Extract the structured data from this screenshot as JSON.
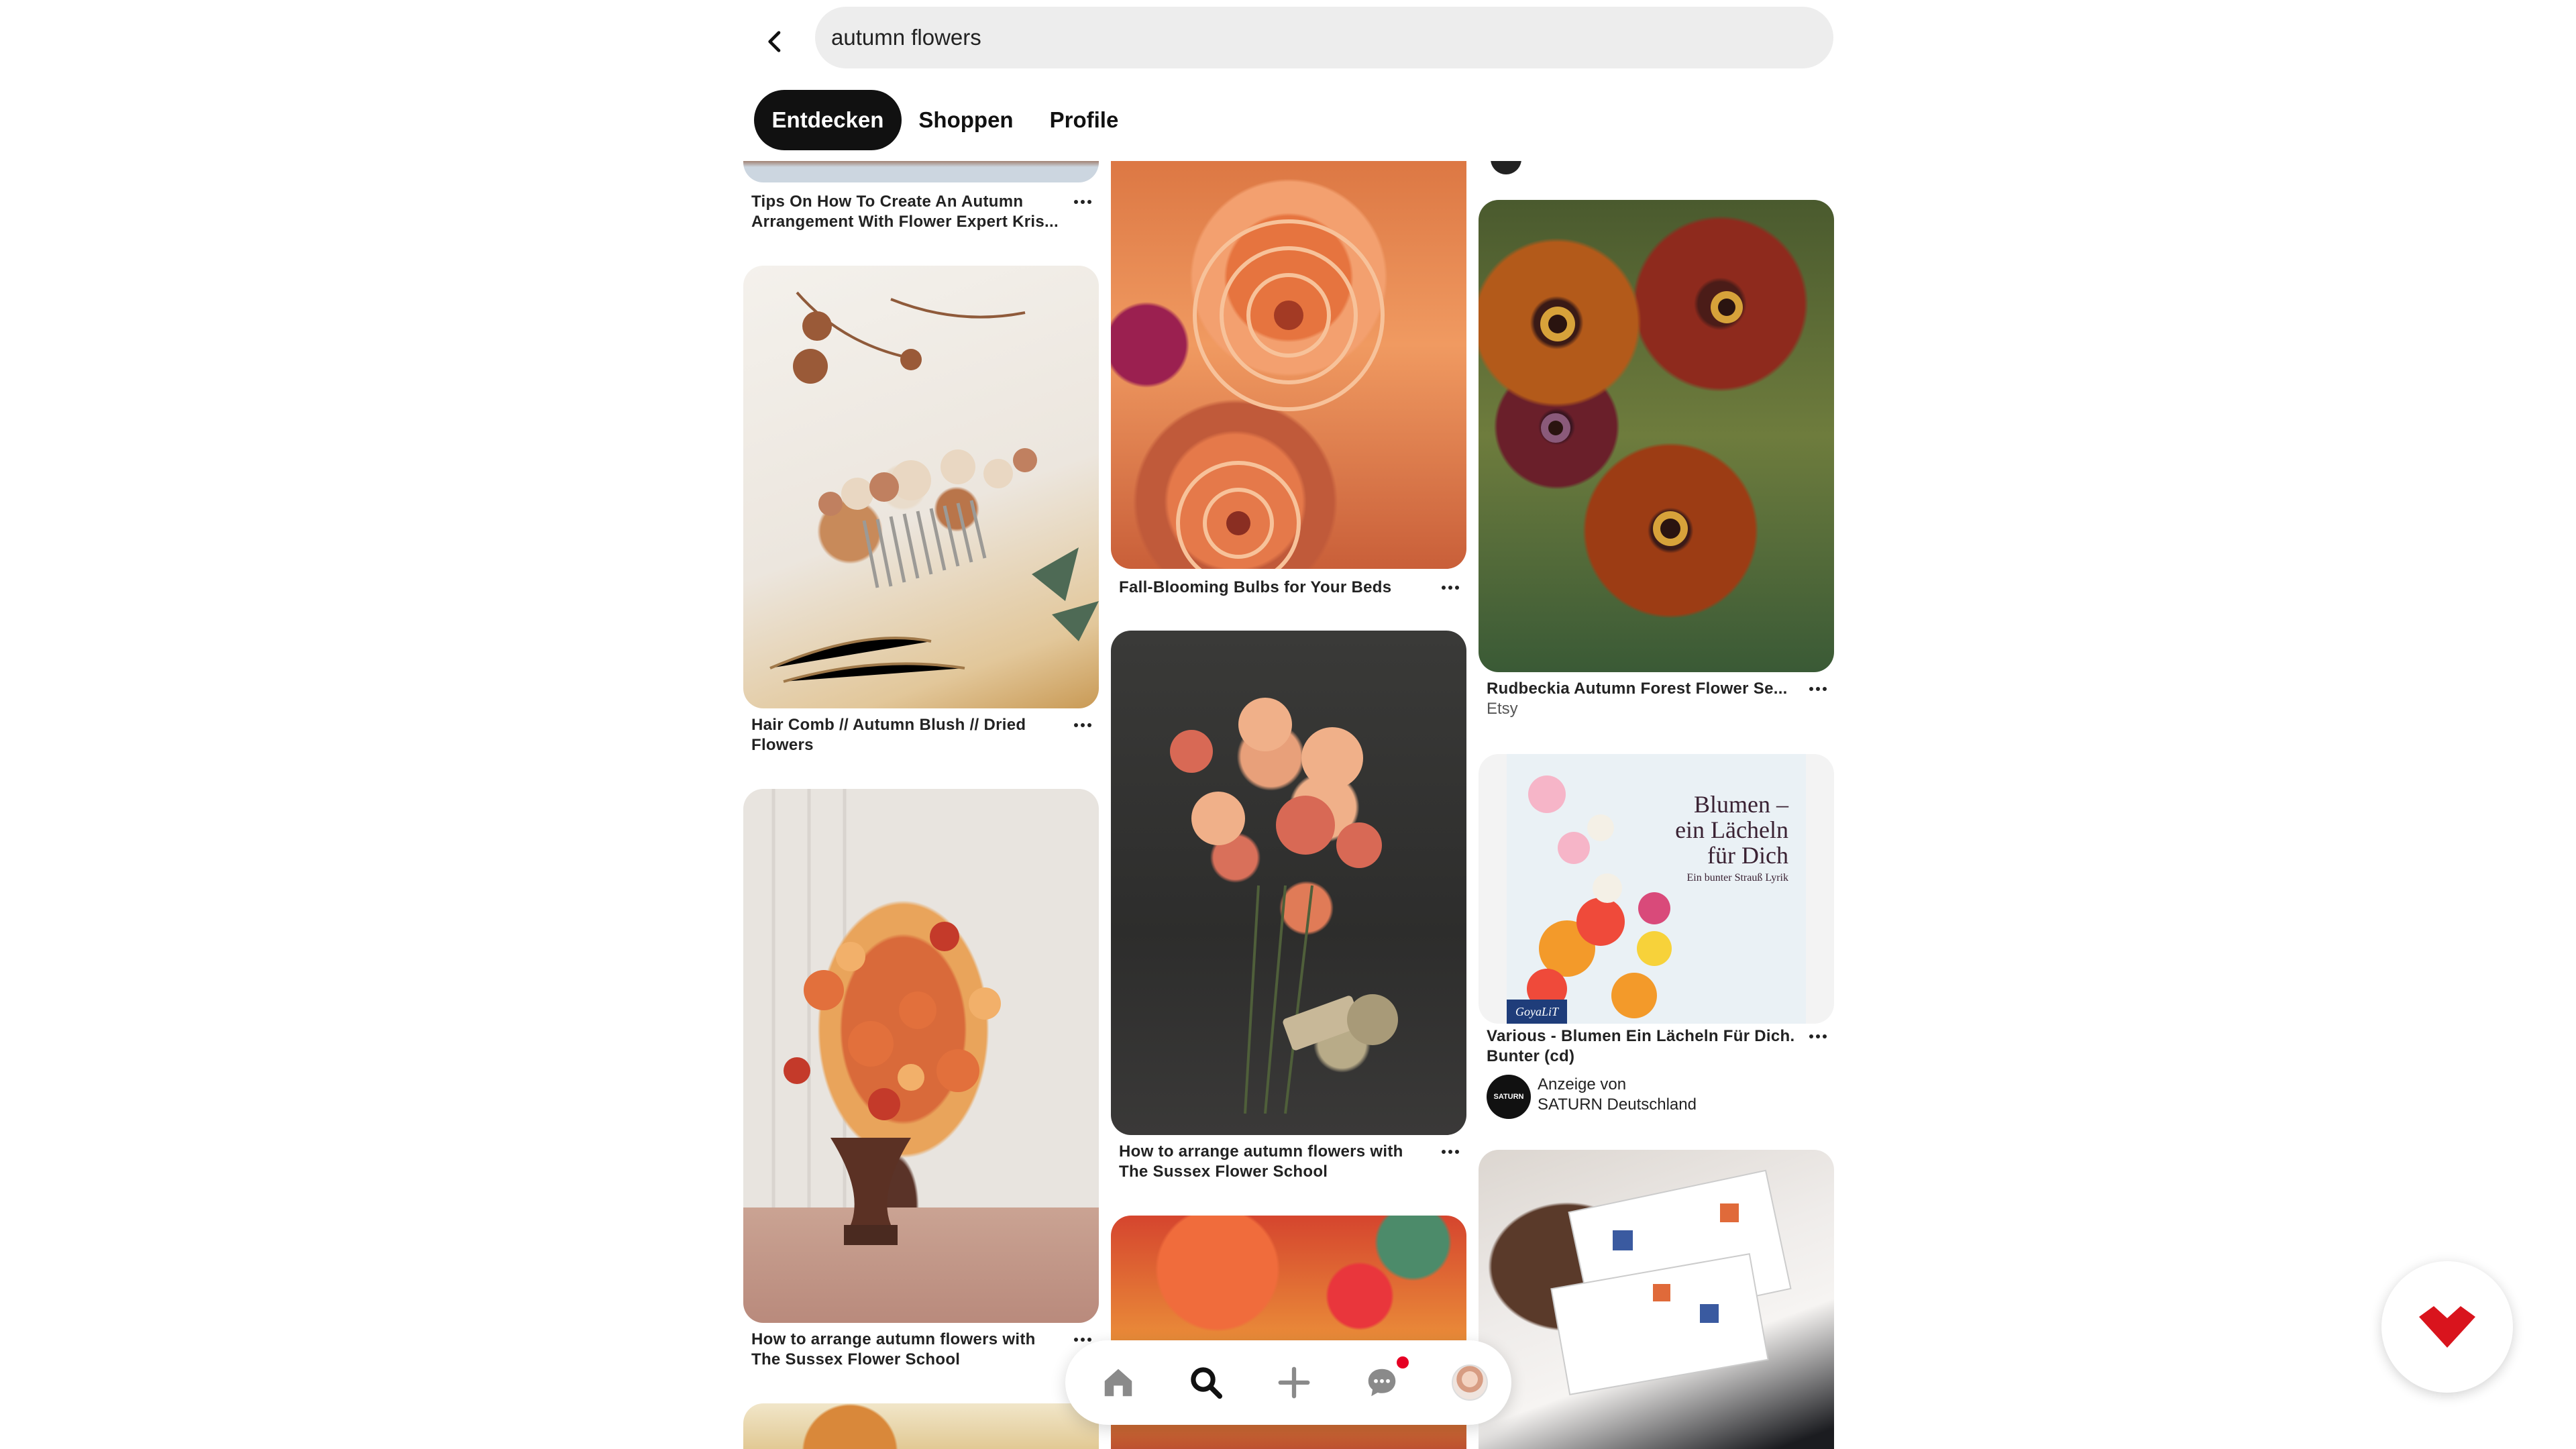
{
  "search": {
    "query": "autumn flowers"
  },
  "tabs": [
    {
      "label": "Entdecken",
      "active": true
    },
    {
      "label": "Shoppen",
      "active": false
    },
    {
      "label": "Profile",
      "active": false
    }
  ],
  "pins": {
    "top_left": {
      "title_line1": "Tips On How To Create An Autumn",
      "title_line2": "Arrangement With Flower Expert Kris..."
    },
    "hair_comb": {
      "title_line1": "Hair Comb // Autumn Blush // Dried",
      "title_line2": "Flowers"
    },
    "urn_arrangement": {
      "title_line1": "How to arrange autumn flowers with",
      "title_line2": "The Sussex Flower School"
    },
    "chrysanthemum": {
      "title_line1": "Fall-Blooming Bulbs for Your Beds"
    },
    "dahlia_dark": {
      "title_line1": "How to arrange autumn flowers with",
      "title_line2": "The Sussex Flower School"
    },
    "rudbeckia": {
      "title_line1": "Rudbeckia Autumn Forest  Flower Se...",
      "subtitle": "Etsy"
    },
    "book": {
      "title_line1": "Various - Blumen Ein Lächeln Für Dich.",
      "title_line2": "Bunter (cd)",
      "ad_label": "Anzeige von",
      "advertiser": "SATURN Deutschland",
      "advertiser_avatar_text": "SATURN",
      "cover_line1": "Blumen –",
      "cover_line2": "ein Lächeln",
      "cover_line3": "für Dich",
      "cover_subtitle": "Ein bunter Strauß Lyrik",
      "cover_publisher": "GoyaLiT"
    }
  },
  "nav": {
    "items": [
      "home-icon",
      "search-icon",
      "plus-icon",
      "chat-icon",
      "avatar"
    ],
    "active": "search-icon",
    "notification": true
  },
  "colors": {
    "accent_red": "#e60023",
    "pill_active": "#111111",
    "search_bg": "#ededed"
  }
}
